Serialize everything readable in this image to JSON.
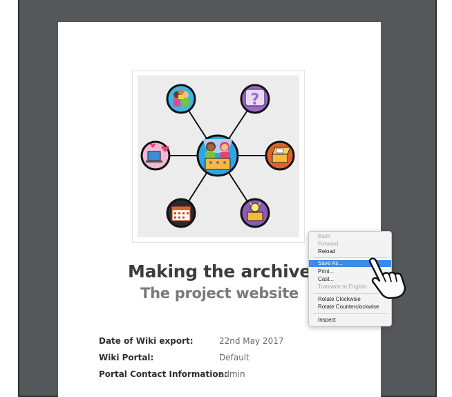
{
  "document": {
    "title": "Making the archive",
    "subtitle": "The project website",
    "info": [
      {
        "label": "Date of Wiki export:",
        "value": "22nd May 2017"
      },
      {
        "label": "Wiki Portal:",
        "value": "Default"
      },
      {
        "label": "Portal Contact Information:",
        "value": "admin"
      }
    ]
  },
  "diagram": {
    "center": "people-with-archive-box-icon",
    "nodes": [
      {
        "icon": "group-of-people-icon",
        "color": "#3db5e6"
      },
      {
        "icon": "question-mark-icon",
        "color": "#9b6bc2"
      },
      {
        "icon": "laptop-with-hearts-icon",
        "color": "#f4b6d2"
      },
      {
        "icon": "open-box-icon",
        "color": "#e2622c"
      },
      {
        "icon": "calendar-icon",
        "color": "#2b2b2b"
      },
      {
        "icon": "lightbulb-box-icon",
        "color": "#8c5bb8"
      }
    ]
  },
  "context_menu": {
    "items": [
      {
        "label": "Back",
        "disabled": true
      },
      {
        "label": "Forward",
        "disabled": true
      },
      {
        "label": "Reload",
        "disabled": false
      },
      {
        "label": "Save As...",
        "disabled": false,
        "highlighted": true
      },
      {
        "label": "Print...",
        "disabled": false
      },
      {
        "label": "Cast...",
        "disabled": false
      },
      {
        "label": "Translate to English",
        "disabled": true
      },
      {
        "label": "Rotate Clockwise",
        "disabled": false
      },
      {
        "label": "Rotate Counterclockwise",
        "disabled": false
      },
      {
        "label": "Inspect",
        "disabled": false
      }
    ]
  },
  "cursor": {
    "icon": "hand-pointer-icon"
  }
}
